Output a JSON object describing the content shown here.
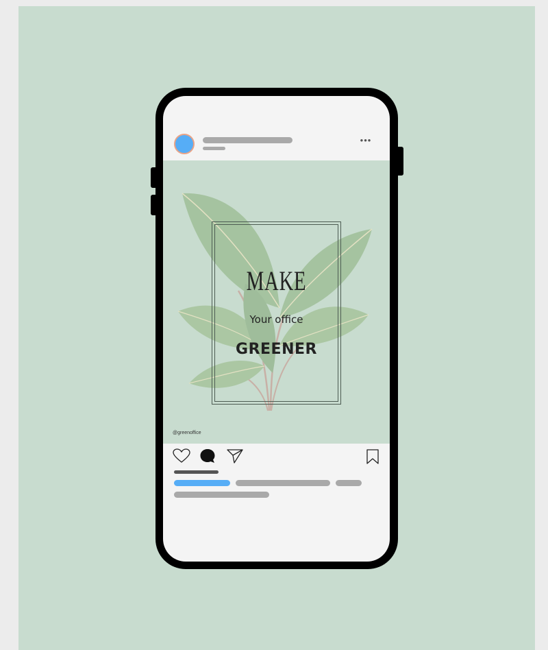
{
  "post": {
    "headline": "MAKE",
    "subheadline": "Your office",
    "tagline": "GREENER",
    "handle": "@greenoffice"
  },
  "header": {
    "more_label": "•••"
  },
  "icons": {
    "like": "heart-icon",
    "comment": "comment-icon",
    "share": "send-icon",
    "save": "bookmark-icon"
  },
  "colors": {
    "background": "#c8dccf",
    "accent": "#56adf6",
    "avatar_ring": "#e9a386",
    "placeholder": "#a9a9a9"
  }
}
